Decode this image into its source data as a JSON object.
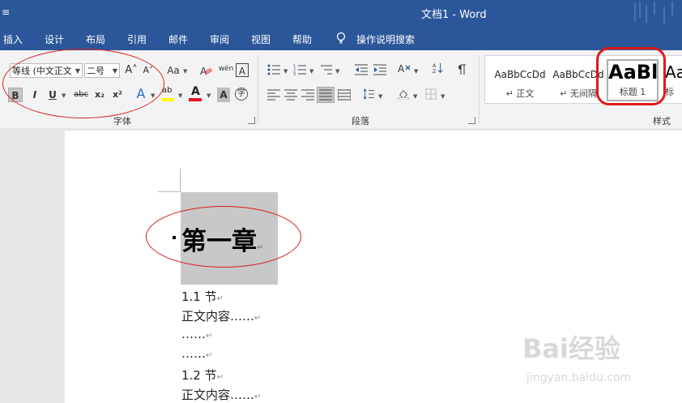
{
  "title_bar": {
    "qa_mark": "≡",
    "title": "文档1 - Word"
  },
  "menu_tabs": [
    "插入",
    "设计",
    "布局",
    "引用",
    "邮件",
    "审阅",
    "视图",
    "帮助",
    "操作说明搜索"
  ],
  "font_group": {
    "font_name": "等线 (中文正文",
    "font_size": "二号",
    "grow_label": "A˄",
    "shrink_label": "A˅",
    "case_label": "Aa",
    "phonetic_label": "wén",
    "border_char_label": "A",
    "bold": "B",
    "italic": "I",
    "underline": "U",
    "strike": "abc",
    "sub": "x₂",
    "sup": "x²",
    "text_effect": "A",
    "highlight": "ab",
    "font_color": "A",
    "shading_char": "A",
    "enclose_char": "字",
    "label": "字体"
  },
  "paragraph_group": {
    "label": "段落"
  },
  "styles_group": {
    "label": "样式",
    "items": [
      {
        "sample": "AaBbCcDd",
        "name": "↵ 正文"
      },
      {
        "sample": "AaBbCcDd",
        "name": "↵ 无间隔"
      },
      {
        "sample": "AaBl",
        "name": "标题 1"
      },
      {
        "sample": "Aa",
        "name": "标"
      }
    ]
  },
  "document": {
    "heading": "第一章",
    "heading_mark": "↵",
    "paragraphs": [
      "1.1 节",
      "正文内容……",
      "……",
      "……",
      "1.2 节",
      "正文内容……"
    ],
    "para_mark": "↵"
  },
  "watermark": {
    "text": "Bai经验",
    "sub": "jingyan.baidu.com"
  },
  "colors": {
    "titlebar": "#2b579a",
    "ribbon": "#f3f3f3",
    "annotation": "#d81e1e",
    "highlight_yellow": "#ffff00",
    "font_red": "#e81123"
  }
}
